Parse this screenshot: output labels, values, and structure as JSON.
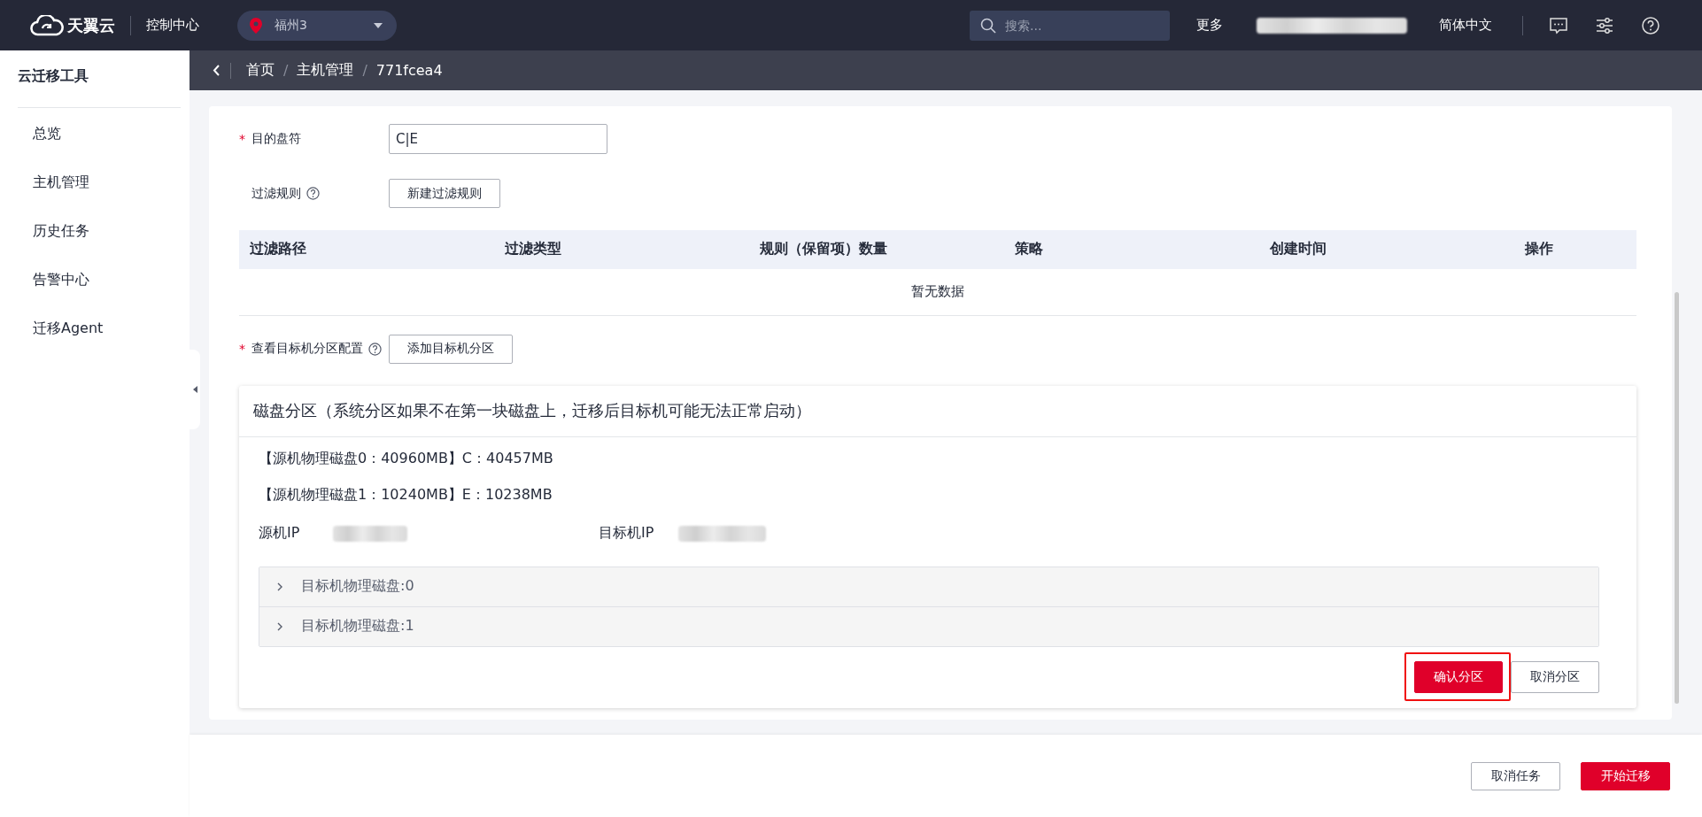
{
  "header": {
    "logo": "天翼云",
    "console": "控制中心",
    "region": "福州3",
    "search": {
      "placeholder": "搜索..."
    },
    "more": "更多",
    "language": "简体中文"
  },
  "sidebar": {
    "title": "云迁移工具",
    "items": [
      {
        "label": "总览",
        "selected": false
      },
      {
        "label": "主机管理",
        "selected": false
      },
      {
        "label": "历史任务",
        "selected": false
      },
      {
        "label": "告警中心",
        "selected": false
      },
      {
        "label": "迁移Agent",
        "selected": false
      }
    ]
  },
  "breadcrumb": [
    {
      "kind": "link",
      "text": "首页"
    },
    {
      "kind": "separator",
      "text": "/"
    },
    {
      "kind": "link",
      "text": "主机管理"
    },
    {
      "kind": "separator",
      "text": "/"
    },
    {
      "kind": "current",
      "text": "771fcea4"
    }
  ],
  "form": {
    "target_drive": {
      "required_mark": "*",
      "label": "目的盘符",
      "value": "C|E"
    },
    "filter_rules": {
      "label": "过滤规则",
      "button": "新建过滤规则"
    },
    "table": {
      "columns": [
        "过滤路径",
        "过滤类型",
        "规则（保留项）数量",
        "策略",
        "创建时间",
        "操作"
      ],
      "empty_text": "暂无数据"
    },
    "partition_config": {
      "required_mark": "*",
      "label": "查看目标机分区配置",
      "button": "添加目标机分区"
    },
    "disk_panel": {
      "title": "磁盘分区（系统分区如果不在第一块磁盘上，迁移后目标机可能无法正常启动）",
      "source_disks": [
        "【源机物理磁盘0：40960MB】C：40457MB",
        "【源机物理磁盘1：10240MB】E：10238MB"
      ],
      "source_ip_label": "源机IP",
      "target_ip_label": "目标机IP",
      "target_disks": [
        {
          "label": "目标机物理磁盘:0",
          "expanded": false
        },
        {
          "label": "目标机物理磁盘:1",
          "expanded": false
        }
      ],
      "buttons": [
        {
          "label": "确认分区",
          "kind": "primary",
          "highlighted": true
        },
        {
          "label": "取消分区",
          "kind": "default",
          "highlighted": false
        }
      ]
    }
  },
  "footer": {
    "buttons": [
      {
        "label": "取消任务",
        "kind": "default"
      },
      {
        "label": "开始迁移",
        "kind": "primary"
      }
    ]
  }
}
